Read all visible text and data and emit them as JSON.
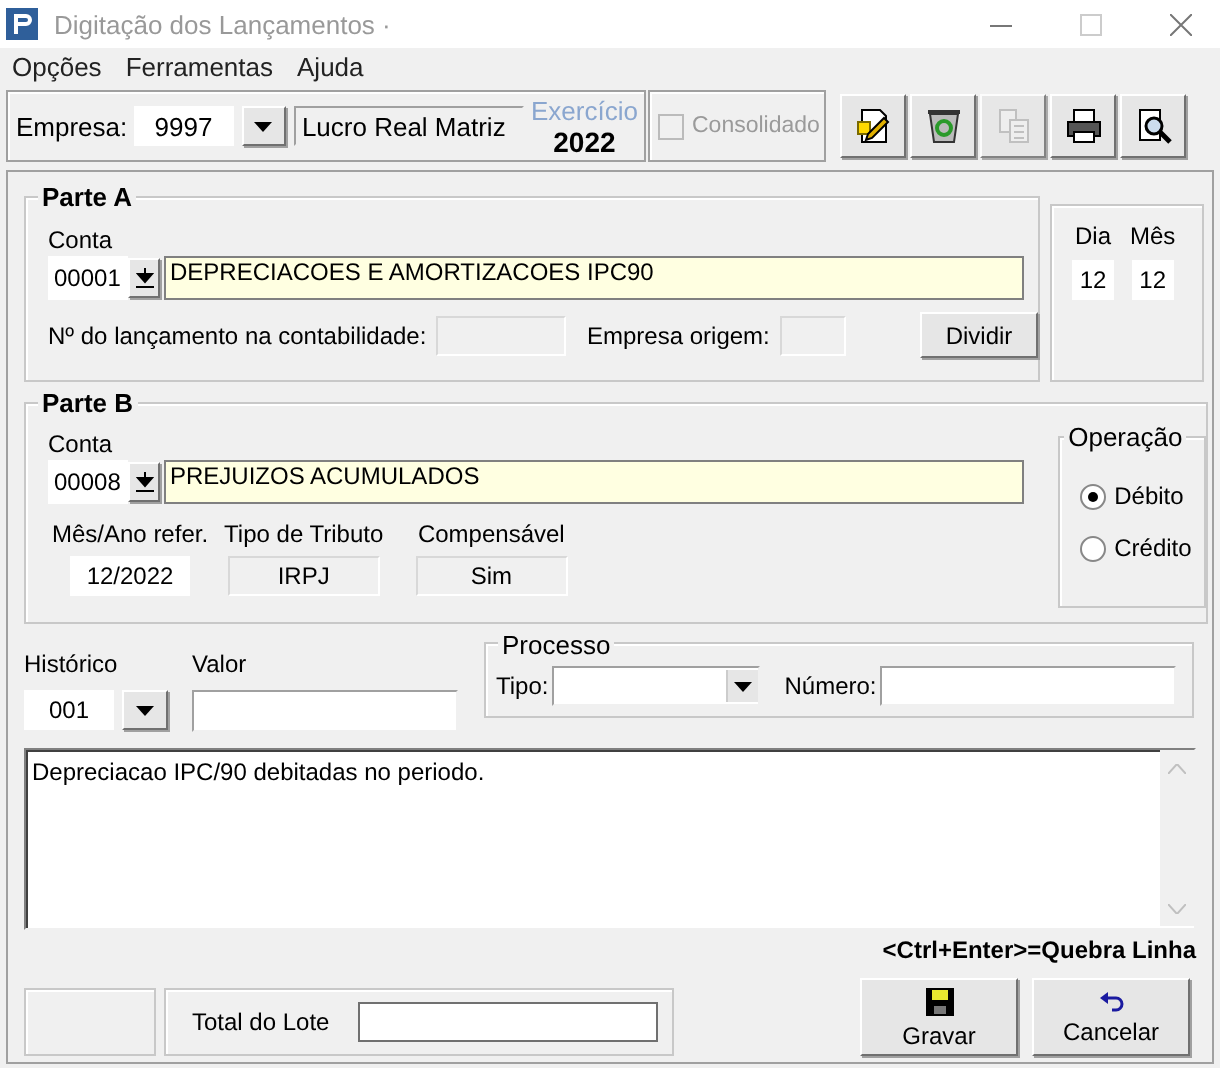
{
  "window": {
    "title": "Digitação dos Lançamentos ·"
  },
  "menu": [
    {
      "label": "Opções"
    },
    {
      "label": "Ferramentas"
    },
    {
      "label": "Ajuda"
    }
  ],
  "empresa": {
    "label": "Empresa:",
    "code": "9997",
    "name": "Lucro Real Matriz"
  },
  "exercicio": {
    "label": "Exercício",
    "year": "2022"
  },
  "consolidado": {
    "label": "Consolidado",
    "checked": false,
    "disabled": true
  },
  "toolbar": [
    {
      "kind": "new",
      "disabled": false
    },
    {
      "kind": "delete",
      "disabled": false
    },
    {
      "kind": "copy",
      "disabled": true
    },
    {
      "kind": "print",
      "disabled": false
    },
    {
      "kind": "find",
      "disabled": false
    }
  ],
  "parte_a": {
    "title": "Parte A",
    "conta_label": "Conta",
    "conta_code": "00001",
    "conta_name": "DEPRECIACOES E AMORTIZACOES IPC90",
    "lancamento_label": "Nº do lançamento na contabilidade:",
    "empresa_origem_label": "Empresa origem:",
    "button": {
      "label": "Dividir"
    }
  },
  "data": {
    "dia_label": "Dia",
    "dia": "12",
    "mes_label": "Mês",
    "mes": "12"
  },
  "parte_b": {
    "title": "Parte B",
    "conta_label": "Conta",
    "conta_code": "00008",
    "conta_name": "PREJUIZOS ACUMULADOS",
    "ref_label": "Mês/Ano refer.",
    "ref": "12/2022",
    "tributo_label": "Tipo de Tributo",
    "tributo": "IRPJ",
    "compensavel_label": "Compensável",
    "compensavel": "Sim"
  },
  "operacao": {
    "title": "Operação",
    "options": [
      {
        "label": "Débito",
        "selected": true
      },
      {
        "label": "Crédito",
        "selected": false
      }
    ]
  },
  "historico": {
    "label": "Histórico",
    "code": "001"
  },
  "valor": {
    "label": "Valor"
  },
  "processo": {
    "title": "Processo",
    "tipo_label": "Tipo:",
    "numero_label": "Número:"
  },
  "texto": "Depreciacao IPC/90 debitadas no periodo.",
  "hint": "<Ctrl+Enter>=Quebra Linha",
  "total": {
    "label": "Total do Lote"
  },
  "actions": [
    {
      "kind": "save",
      "label": "Gravar"
    },
    {
      "kind": "undo",
      "label": "Cancelar"
    }
  ]
}
